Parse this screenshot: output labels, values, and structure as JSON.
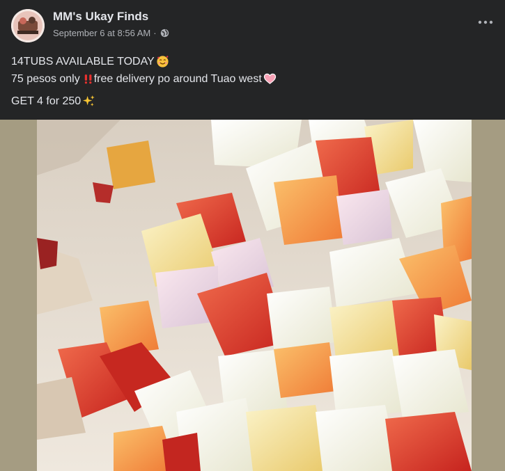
{
  "post": {
    "page_name": "MM's Ukay Finds",
    "timestamp": "September 6 at 8:56 AM",
    "separator": "·",
    "audience_icon": "globe-icon",
    "more_icon": "more-options-icon",
    "avatar_icon": "page-avatar-logo",
    "text_lines": {
      "line1": "14TUBS AVAILABLE TODAY",
      "line1_emoji": "smiling-face-with-hearts",
      "line2": "75 pesos only",
      "line2_emoji_a": "double-exclamation",
      "line2_rest": " free delivery po around Tuao west",
      "line2_emoji_b": "pink-heart",
      "line3": "GET 4 for 250",
      "line3_emoji": "sparkles"
    },
    "photo": {
      "subject": "fruit-salad-photo",
      "colors": {
        "background": "#a59c82",
        "cream": "#e9e2d6",
        "pineapple": "#f1d98a",
        "red_pepper": "#d8332a",
        "orange_bits": "#ef7a35"
      }
    }
  },
  "theme": {
    "card_bg": "#242526",
    "primary_text": "#e4e6eb",
    "secondary_text": "#b0b3b8"
  }
}
